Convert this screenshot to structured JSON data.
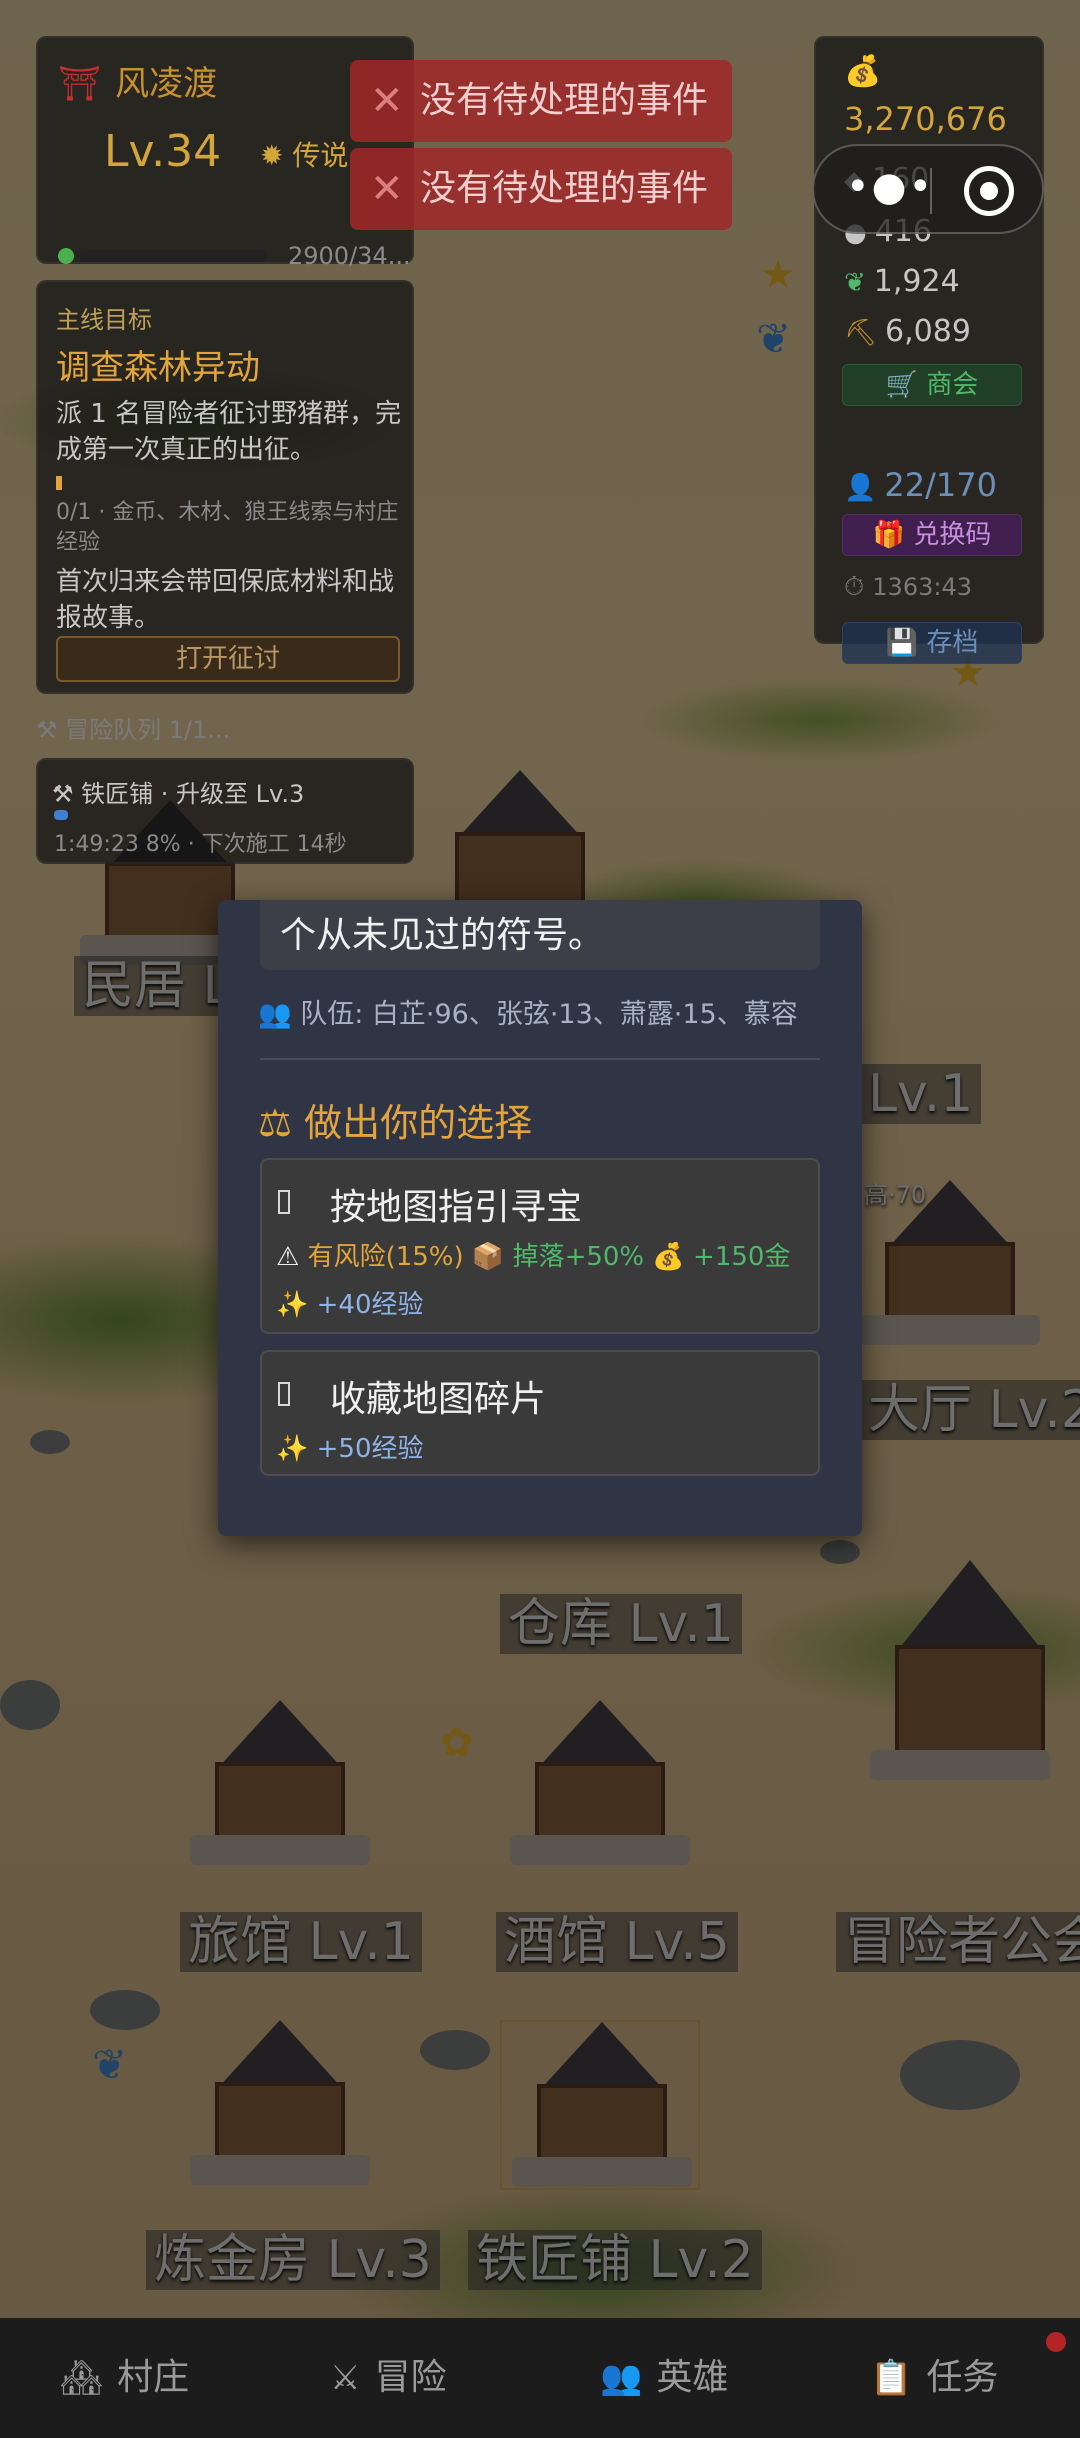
{
  "player": {
    "name": "风凌渡",
    "level": "Lv.34",
    "rank": "传说",
    "xp": "2900/34..."
  },
  "events": [
    "没有待处理的事件",
    "没有待处理的事件"
  ],
  "quest": {
    "heading": "主线目标",
    "title": "调查森林异动",
    "description": "派 1 名冒险者征讨野猪群，完成第一次真正的出征。",
    "progress": "0/1 · 金币、木材、狼王线索与村庄经验",
    "note": "首次归来会带回保底材料和战报故事。",
    "button": "打开征讨"
  },
  "team_row": "冒险队列 1/1...",
  "construction": {
    "title": "铁匠铺 · 升级至 Lv.3",
    "info": "1:49:23 8% · 下次施工 14秒"
  },
  "resources": {
    "gold": "3,270,676",
    "r2": "160",
    "r3": "416",
    "r4": "1,924",
    "r5": "6,089",
    "shop": "商会",
    "heroes": "22/170",
    "code": "兑换码",
    "time": "1363:43",
    "save": "存档"
  },
  "icons": {
    "gate": "torii-gate-icon",
    "rank": "sun-badge-icon",
    "gold": "money-bag-icon",
    "shop": "cart-icon",
    "heroes": "person-icon",
    "code": "gift-icon",
    "time": "clock-icon",
    "save": "floppy-icon"
  },
  "buildings": {
    "minju": "民居 L",
    "hall_a": "Lv.1",
    "hall_b": "大厅 Lv.2",
    "warehouse": "仓库 Lv.1",
    "inn": "旅馆 Lv.1",
    "tavern": "酒馆 Lv.5",
    "guild": "冒险者公会",
    "alchemy": "炼金房 Lv.3",
    "smithy": "铁匠铺 Lv.2",
    "hall_tag": "高·70"
  },
  "dialog": {
    "story": "个从未见过的符号。",
    "team": "队伍: 白芷·96、张弦·13、萧露·15、慕容",
    "choose_title": "做出你的选择",
    "choices": [
      {
        "title": "按地图指引寻宝",
        "risk": "有风险(15%)",
        "drop": "掉落+50%",
        "gold": "+150金",
        "xp": "+40经验"
      },
      {
        "title": "收藏地图碎片",
        "xp": "+50经验"
      }
    ]
  },
  "nav": [
    {
      "label": "村庄",
      "icon": "house-icon"
    },
    {
      "label": "冒险",
      "icon": "swords-icon"
    },
    {
      "label": "英雄",
      "icon": "heroes-icon"
    },
    {
      "label": "任务",
      "icon": "clipboard-icon"
    }
  ],
  "colors": {
    "accent_gold": "#e3a43a",
    "dialog_bg": "#2f3544",
    "event_red": "#a02828",
    "xp_blue": "#8fb3e8",
    "success_green": "#4fb86a"
  }
}
